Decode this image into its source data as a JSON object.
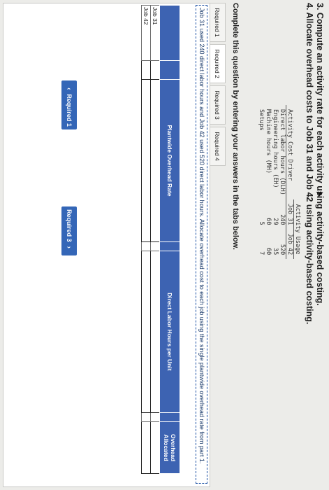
{
  "instructions": {
    "line3": "3. Compute an activity rate for each activity using activity-based costing.",
    "line4": "4. Allocate overhead costs to Job 31 and Job 42 using activity-based costing."
  },
  "cost_table": {
    "driver_header": "Activity Cost Driver",
    "usage_header": "Activity Usage",
    "col1": "Job 31",
    "col2": "Job 42",
    "rows": [
      {
        "driver": "Direct labor hours (DLH)",
        "job31": "240",
        "job42": "520"
      },
      {
        "driver": "Engineering hours (EH)",
        "job31": "29",
        "job42": "35"
      },
      {
        "driver": "Machine hours (MH)",
        "job31": "60",
        "job42": "60"
      },
      {
        "driver": "Setups",
        "job31": "5",
        "job42": "7"
      }
    ]
  },
  "complete_text": "Complete this question by entering your answers in the tabs below.",
  "tabs": [
    "Required 1",
    "Required 2",
    "Required 3",
    "Required 4"
  ],
  "note": "Job 31 used 240 direct labor hours and Job 42 used 520 direct labor hours. Allocate overhead cost to each job using the single plantwide overhead rate from part 1.",
  "grid": {
    "headers": {
      "plantwide": "Plantwide Overhead Rate",
      "dlh": "Direct Labor Hours per Unit",
      "overhead": "Overhead Allocated"
    },
    "rows": [
      "Job 31",
      "Job 42"
    ]
  },
  "nav": {
    "prev": "Required 1",
    "next": "Required 3"
  }
}
